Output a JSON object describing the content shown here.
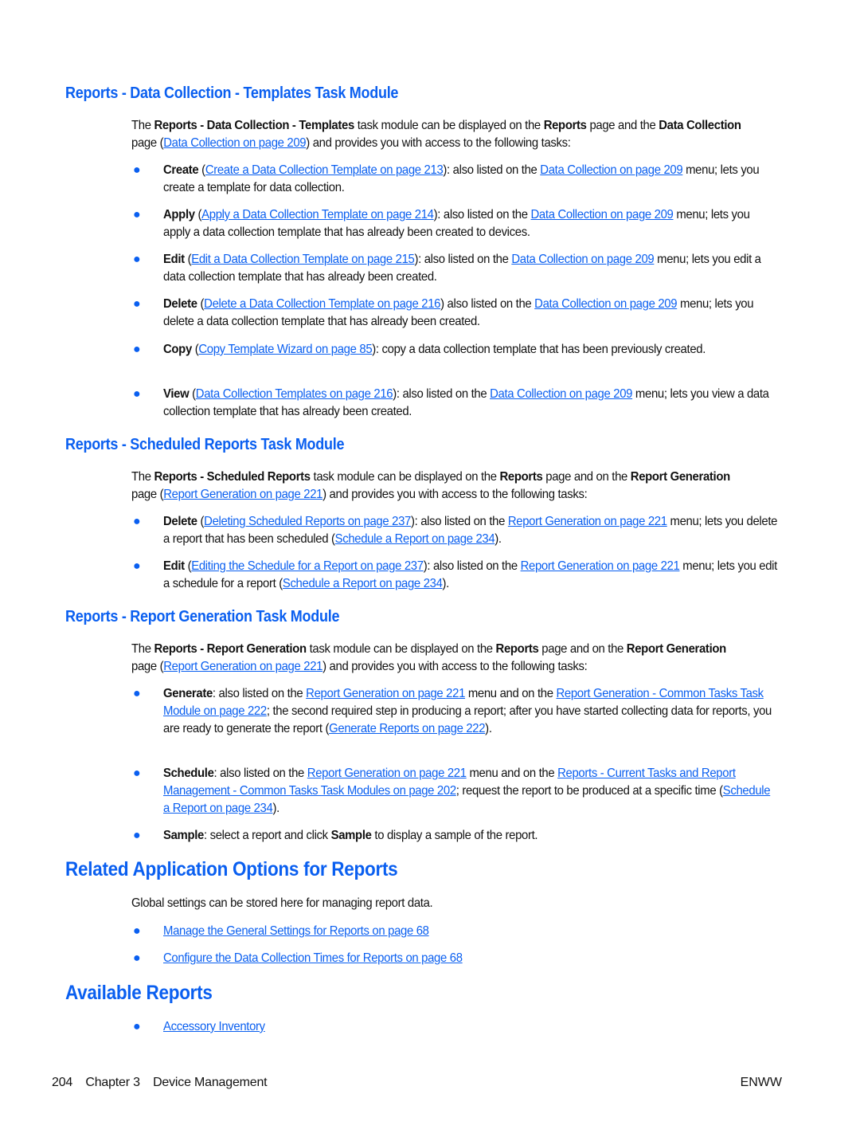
{
  "accent_color": "#0a5ff0",
  "sections": {
    "templates": {
      "heading": "Reports - Data Collection - Templates Task Module",
      "intro": {
        "t1": "The ",
        "b1": "Reports - Data Collection - Templates",
        "t2": " task module can be displayed on the ",
        "b2": "Reports",
        "t3": " page and the ",
        "b3": "Data Collection",
        "t4": " page (",
        "link": "Data Collection on page 209",
        "t5": ") and provides you with access to the following tasks:"
      },
      "items": [
        {
          "label": "Create",
          "pre": " (",
          "link": "Create a Data Collection Template on page 213",
          "mid": "): also listed on the ",
          "link2": "Data Collection on page 209",
          "post": " menu; lets you create a template for data collection."
        },
        {
          "label": "Apply",
          "pre": " (",
          "link": "Apply a Data Collection Template on page 214",
          "mid": "): also listed on the ",
          "link2": "Data Collection on page 209",
          "post": " menu; lets you apply a data collection template that has already been created to devices."
        },
        {
          "label": "Edit",
          "pre": " (",
          "link": "Edit a Data Collection Template on page 215",
          "mid": "): also listed on the ",
          "link2": "Data Collection on page 209",
          "post": " menu; lets you edit a data collection template that has already been created."
        },
        {
          "label": "Delete",
          "pre": " (",
          "link": "Delete a Data Collection Template on page 216",
          "mid": ") also listed on the ",
          "link2": "Data Collection on page 209",
          "post": " menu; lets you delete a data collection template that has already been created."
        },
        {
          "label": "Copy",
          "pre": " (",
          "link": "Copy Template Wizard on page 85",
          "mid": "): copy a data collection template that has been previously created.",
          "link2": "",
          "post": ""
        },
        {
          "label": "View",
          "pre": " (",
          "link": "Data Collection Templates on page 216",
          "mid": "): also listed on the ",
          "link2": "Data Collection on page 209",
          "post": " menu; lets you view a data collection template that has already been created."
        }
      ]
    },
    "scheduled": {
      "heading": "Reports - Scheduled Reports Task Module",
      "intro": {
        "t1": "The ",
        "b1": "Reports - Scheduled Reports",
        "t2": " task module can be displayed on the ",
        "b2": "Reports",
        "t3": " page and on the ",
        "b3": "Report Generation",
        "t4": " page (",
        "link": "Report Generation on page 221",
        "t5": ") and provides you with access to the following tasks:"
      },
      "items": [
        {
          "label": "Delete",
          "pre": " (",
          "link": "Deleting Scheduled Reports on page 237",
          "mid": "): also listed on the ",
          "link2": "Report Generation on page 221",
          "post": " menu; lets you delete a report that has been scheduled (",
          "link3": "Schedule a Report on page 234",
          "end": ")."
        },
        {
          "label": "Edit",
          "pre": " (",
          "link": "Editing the Schedule for a Report on page 237",
          "mid": "): also listed on the ",
          "link2": "Report Generation on page 221",
          "post": " menu; lets you edit a schedule for a report (",
          "link3": "Schedule a Report on page 234",
          "end": ")."
        }
      ]
    },
    "generation": {
      "heading": "Reports - Report Generation Task Module",
      "intro": {
        "t1": "The ",
        "b1": "Reports - Report Generation",
        "t2": " task module can be displayed on the ",
        "b2": "Reports",
        "t3": " page and on the ",
        "b3": "Report Generation",
        "t4": " page (",
        "link": "Report Generation on page 221",
        "t5": ") and provides you with access to the following tasks:"
      },
      "items": [
        {
          "label": "Generate",
          "pre": ": also listed on the ",
          "link": "Report Generation on page 221",
          "mid": " menu and on the ",
          "link2": "Report Generation - Common Tasks Task Module on page 222",
          "post": "; the second required step in producing a report; after you have started collecting data for reports, you are ready to generate the report (",
          "link3": "Generate Reports on page 222",
          "end": ")."
        },
        {
          "label": "Schedule",
          "pre": ": also listed on the ",
          "link": "Report Generation on page 221",
          "mid": " menu and on the ",
          "link2": "Reports - Current Tasks and Report Management - Common Tasks Task Modules on page 202",
          "post": "; request the report to be produced at a specific time (",
          "link3": "Schedule a Report on page 234",
          "end": ")."
        },
        {
          "label": "Sample",
          "pre": ": select a report and click ",
          "bold2": "Sample",
          "post": " to display a sample of the report."
        }
      ]
    },
    "related": {
      "heading": "Related Application Options for Reports",
      "intro": "Global settings can be stored here for managing report data.",
      "links": [
        "Manage the General Settings for Reports on page 68",
        "Configure the Data Collection Times for Reports on page 68"
      ]
    },
    "available": {
      "heading": "Available Reports",
      "links": [
        "Accessory Inventory"
      ]
    }
  },
  "footer": {
    "page_number": "204",
    "chapter": "Chapter 3",
    "chapter_title": "Device Management",
    "locale_code": "ENWW"
  }
}
